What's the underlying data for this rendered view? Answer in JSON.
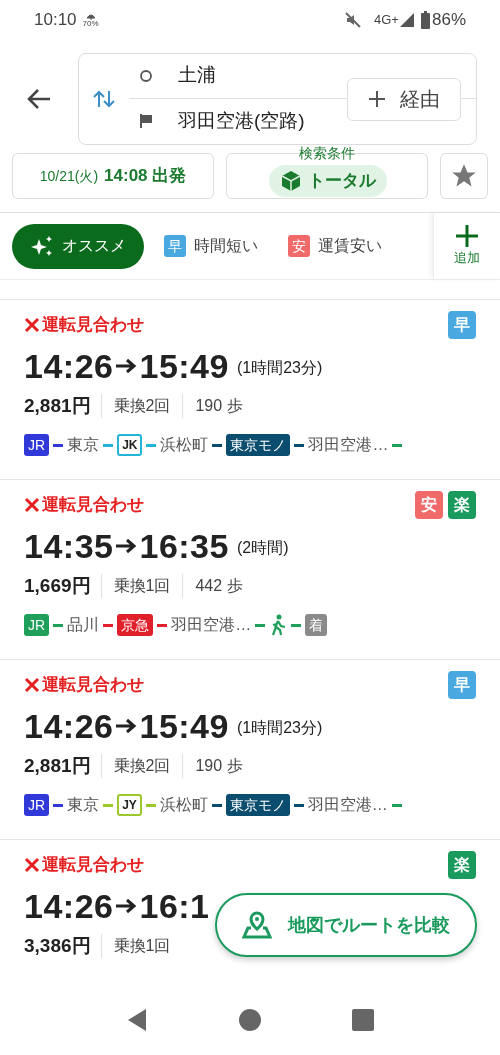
{
  "status_bar": {
    "time": "10:10",
    "weather_percent": "70%",
    "network": "4G+",
    "battery": "86%"
  },
  "search": {
    "origin": "土浦",
    "destination": "羽田空港(空路)",
    "via_button": "経由"
  },
  "options": {
    "date": "10/21(火)",
    "departure": "14:08 出発",
    "conditions_label": "検索条件",
    "conditions_value": "トータル"
  },
  "sort_tabs": [
    {
      "kind": "sparkle",
      "label": "オススメ",
      "selected": true
    },
    {
      "kind": "badge",
      "badge": "早",
      "color": "#4aa8e0",
      "label": "時間短い",
      "selected": false
    },
    {
      "kind": "badge",
      "badge": "安",
      "color": "#f06a6a",
      "label": "運賃安い",
      "selected": false
    }
  ],
  "add_button": "追加",
  "routes": [
    {
      "status": "運転見合わせ",
      "depart": "14:26",
      "arrive": "15:49",
      "duration": "(1時間23分)",
      "fare": "2,881円",
      "transfers": "乗換2回",
      "steps": "190 歩",
      "tags": [
        {
          "label": "早",
          "color": "#4aa8e0"
        }
      ],
      "route": [
        {
          "kind": "badge",
          "label": "JR",
          "color": "#3038d8"
        },
        {
          "kind": "dash",
          "color": "#3038d8"
        },
        {
          "kind": "station",
          "label": "東京"
        },
        {
          "kind": "dash",
          "color": "#22b5d8"
        },
        {
          "kind": "outline",
          "label": "JK",
          "color": "#22b5d8"
        },
        {
          "kind": "dash",
          "color": "#22b5d8"
        },
        {
          "kind": "station",
          "label": "浜松町"
        },
        {
          "kind": "dash",
          "color": "#0b4d6e"
        },
        {
          "kind": "badge",
          "label": "東京モノ",
          "color": "#0b4d6e"
        },
        {
          "kind": "dash",
          "color": "#0b4d6e"
        },
        {
          "kind": "station",
          "label": "羽田空港…"
        },
        {
          "kind": "dash",
          "color": "#1ea05a"
        }
      ]
    },
    {
      "status": "運転見合わせ",
      "depart": "14:35",
      "arrive": "16:35",
      "duration": "(2時間)",
      "fare": "1,669円",
      "transfers": "乗換1回",
      "steps": "442 歩",
      "tags": [
        {
          "label": "安",
          "color": "#f06a6a"
        },
        {
          "label": "楽",
          "color": "#1a9a5c"
        }
      ],
      "route": [
        {
          "kind": "badge",
          "label": "JR",
          "color": "#1ea05a"
        },
        {
          "kind": "dash",
          "color": "#1ea05a"
        },
        {
          "kind": "station",
          "label": "品川"
        },
        {
          "kind": "dash",
          "color": "#e0202a"
        },
        {
          "kind": "badge",
          "label": "京急",
          "color": "#e0202a"
        },
        {
          "kind": "dash",
          "color": "#e0202a"
        },
        {
          "kind": "station",
          "label": "羽田空港…"
        },
        {
          "kind": "dash",
          "color": "#1ea05a"
        },
        {
          "kind": "walk",
          "color": "#1ea05a"
        },
        {
          "kind": "dash",
          "color": "#1ea05a"
        },
        {
          "kind": "badge",
          "label": "着",
          "color": "#8a8a8a"
        }
      ]
    },
    {
      "status": "運転見合わせ",
      "depart": "14:26",
      "arrive": "15:49",
      "duration": "(1時間23分)",
      "fare": "2,881円",
      "transfers": "乗換2回",
      "steps": "190 歩",
      "tags": [
        {
          "label": "早",
          "color": "#4aa8e0"
        }
      ],
      "route": [
        {
          "kind": "badge",
          "label": "JR",
          "color": "#3038d8"
        },
        {
          "kind": "dash",
          "color": "#3038d8"
        },
        {
          "kind": "station",
          "label": "東京"
        },
        {
          "kind": "dash",
          "color": "#9bc92a"
        },
        {
          "kind": "outline",
          "label": "JY",
          "color": "#9bc92a"
        },
        {
          "kind": "dash",
          "color": "#9bc92a"
        },
        {
          "kind": "station",
          "label": "浜松町"
        },
        {
          "kind": "dash",
          "color": "#0b4d6e"
        },
        {
          "kind": "badge",
          "label": "東京モノ",
          "color": "#0b4d6e"
        },
        {
          "kind": "dash",
          "color": "#0b4d6e"
        },
        {
          "kind": "station",
          "label": "羽田空港…"
        },
        {
          "kind": "dash",
          "color": "#1ea05a"
        }
      ]
    },
    {
      "status": "運転見合わせ",
      "depart": "14:26",
      "arrive": "16:1",
      "fare": "3,386円",
      "transfers": "乗換1回",
      "tags": [
        {
          "label": "楽",
          "color": "#1a9a5c"
        }
      ]
    }
  ],
  "map_compare_button": "地図でルートを比較"
}
